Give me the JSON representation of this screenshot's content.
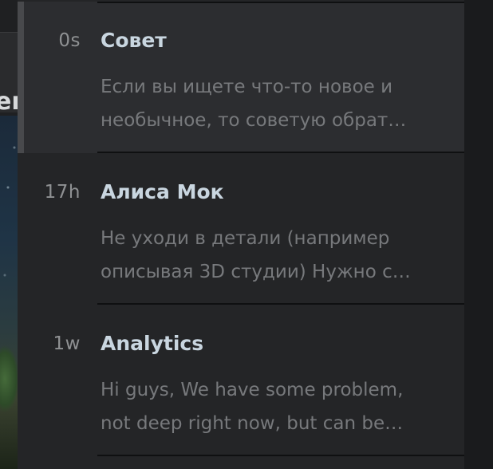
{
  "backdrop": {
    "partial_heading": "er"
  },
  "notifications": [
    {
      "time": "0s",
      "title": "Совет",
      "preview_line1": "Если вы ищете что-то новое и",
      "preview_line2": "необычное, то советую обрат…",
      "active": true
    },
    {
      "time": "17h",
      "title": "Алиса Мок",
      "preview_line1": "Не уходи в детали (например",
      "preview_line2": "описывая 3D студии) Нужно с…",
      "active": false
    },
    {
      "time": "1w",
      "title": "Analytics",
      "preview_line1": "Hi guys, We have some problem,",
      "preview_line2": "not deep right now, but can be…",
      "active": false
    }
  ],
  "colors": {
    "panel_bg": "#242527",
    "active_bg": "#2c2d30",
    "title": "#c9d6e0",
    "preview": "#77797c",
    "time": "#8f9193"
  }
}
